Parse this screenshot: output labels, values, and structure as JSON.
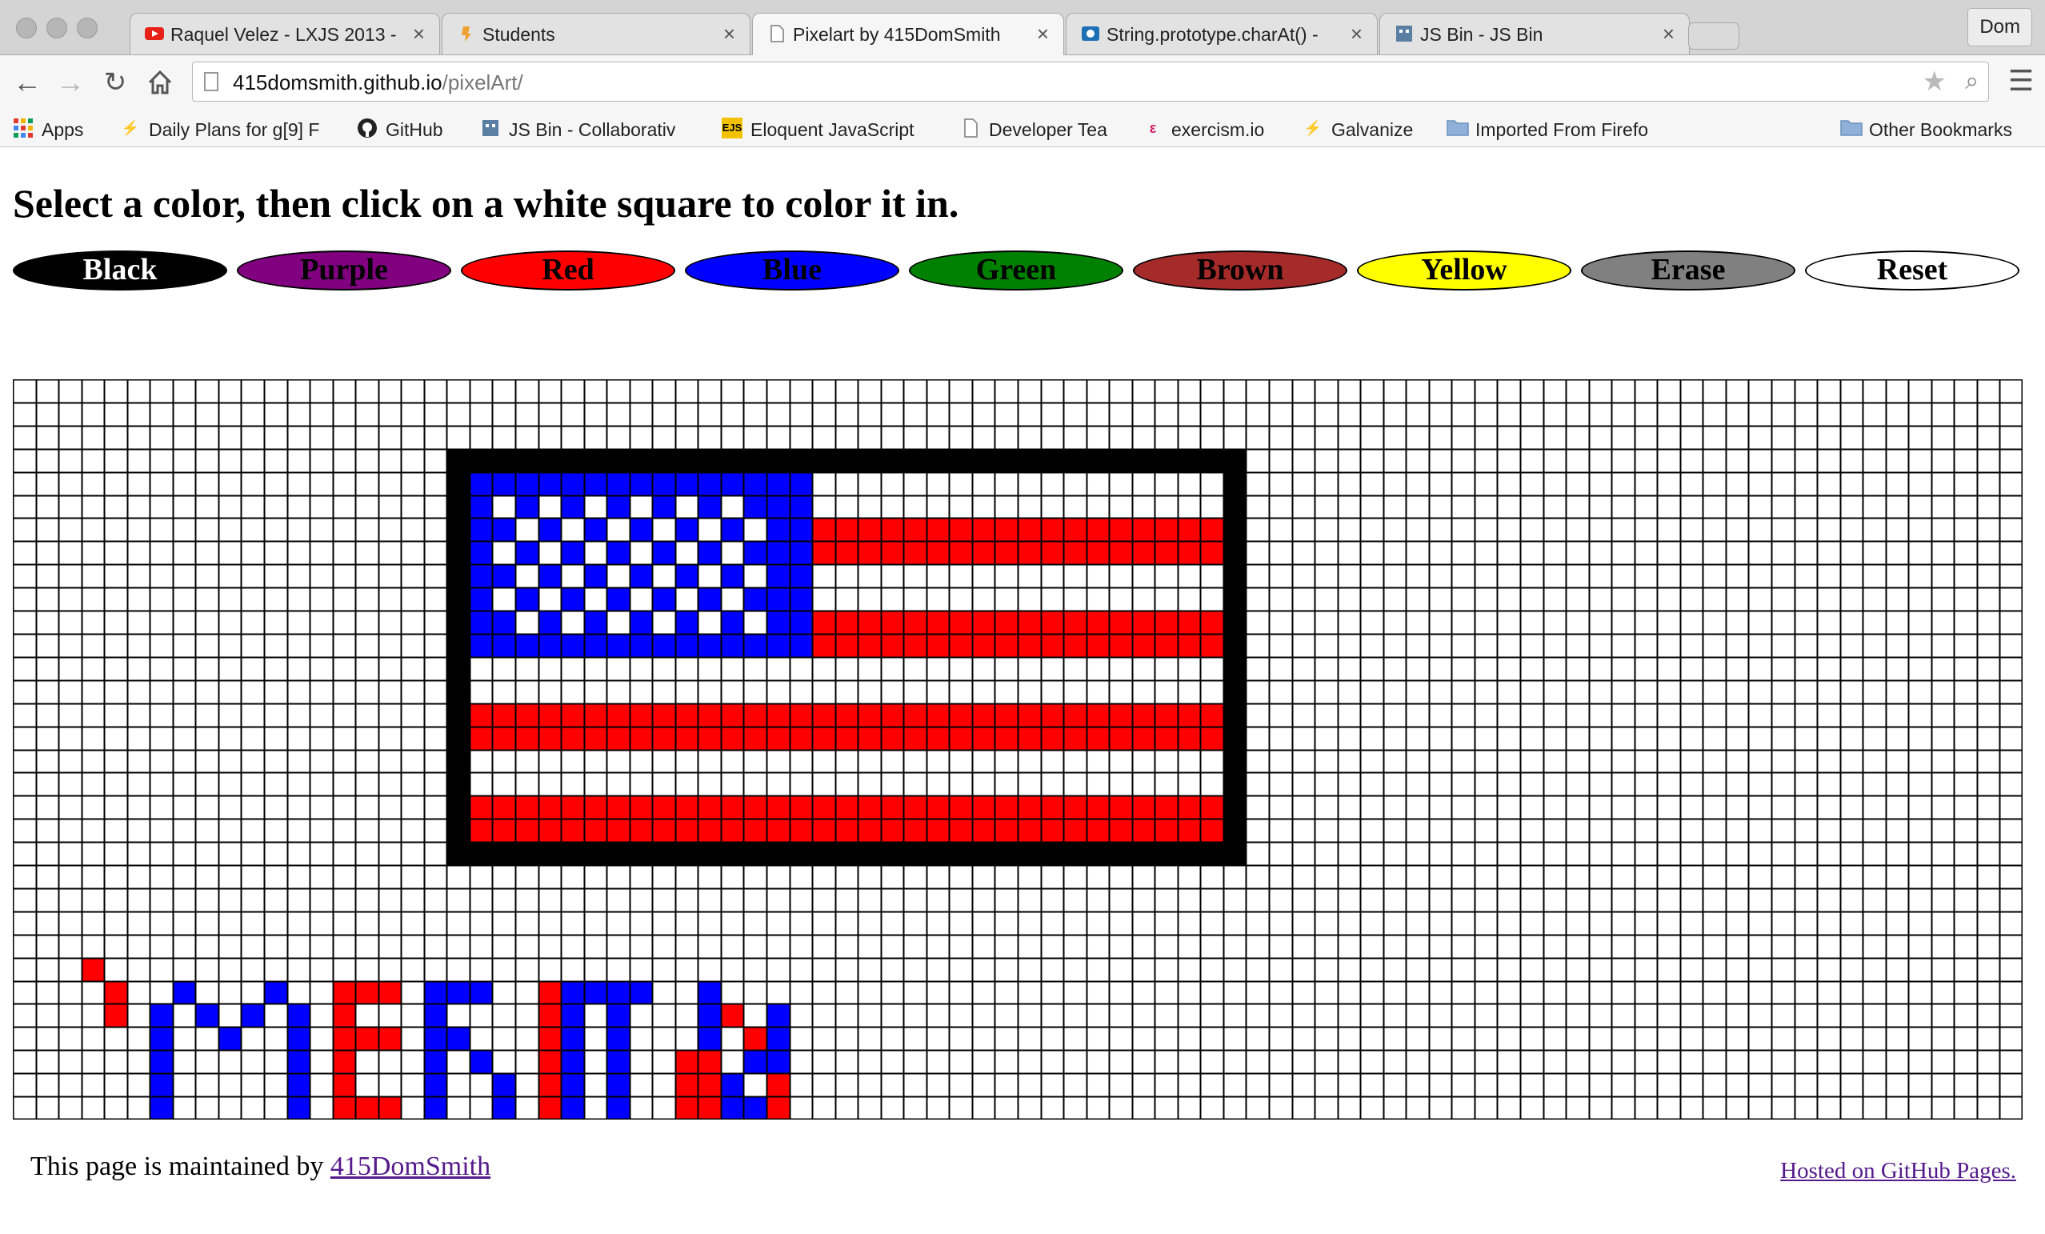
{
  "browser": {
    "tabs": [
      {
        "title": "Raquel Velez - LXJS 2013 -",
        "icon": "youtube-icon",
        "icon_color": "#e62117",
        "active": false
      },
      {
        "title": "Students",
        "icon": "galvanize-icon",
        "icon_color": "#f0a030",
        "active": false
      },
      {
        "title": "Pixelart by 415DomSmith",
        "icon": "page-icon",
        "icon_color": "#999999",
        "active": true
      },
      {
        "title": "String.prototype.charAt() -",
        "icon": "mdn-icon",
        "icon_color": "#1f6fb5",
        "active": false
      },
      {
        "title": "JS Bin - JS Bin",
        "icon": "jsbin-icon",
        "icon_color": "#5b7fa3",
        "active": false
      }
    ],
    "profile_name": "Dom",
    "url_host": "415domsmith.github.io",
    "url_path": "/pixelArt/",
    "bookmarks": [
      {
        "label": "Apps",
        "icon": "apps-grid-icon"
      },
      {
        "label": "Daily Plans for g[9] F",
        "icon": "galvanize-icon"
      },
      {
        "label": "GitHub",
        "icon": "github-icon"
      },
      {
        "label": "JS Bin - Collaborativ",
        "icon": "jsbin-icon"
      },
      {
        "label": "Eloquent JavaScript",
        "icon": "ejs-icon"
      },
      {
        "label": "Developer Tea",
        "icon": "page-icon"
      },
      {
        "label": "exercism.io",
        "icon": "exercism-icon"
      },
      {
        "label": "Galvanize",
        "icon": "galvanize-icon"
      },
      {
        "label": "Imported From Firefo",
        "icon": "folder-icon"
      }
    ],
    "other_bookmarks": "Other Bookmarks"
  },
  "page": {
    "heading": "Select a color, then click on a white square to color it in.",
    "buttons": [
      {
        "label": "Black",
        "bg": "#000000",
        "fg": "#ffffff"
      },
      {
        "label": "Purple",
        "bg": "#800080",
        "fg": "#000000"
      },
      {
        "label": "Red",
        "bg": "#ff0000",
        "fg": "#000000"
      },
      {
        "label": "Blue",
        "bg": "#0000ff",
        "fg": "#000000"
      },
      {
        "label": "Green",
        "bg": "#008000",
        "fg": "#000000"
      },
      {
        "label": "Brown",
        "bg": "#a52a2a",
        "fg": "#000000"
      },
      {
        "label": "Yellow",
        "bg": "#ffff00",
        "fg": "#000000"
      },
      {
        "label": "Erase",
        "bg": "#808080",
        "fg": "#000000"
      },
      {
        "label": "Reset",
        "bg": "#ffffff",
        "fg": "#000000"
      }
    ],
    "canvas": {
      "columns": 88,
      "rows": 32,
      "colors": {
        "K": "#000000",
        "B": "#0000ff",
        "R": "#ff0000",
        "W": "#ffffff"
      },
      "fills": [
        {
          "color": "K",
          "col": 19,
          "row": 3,
          "w": 35,
          "h": 1
        },
        {
          "color": "K",
          "col": 19,
          "row": 20,
          "w": 35,
          "h": 1
        },
        {
          "color": "K",
          "col": 19,
          "row": 4,
          "w": 1,
          "h": 16
        },
        {
          "color": "K",
          "col": 53,
          "row": 4,
          "w": 1,
          "h": 16
        },
        {
          "color": "B",
          "col": 20,
          "row": 4,
          "w": 15,
          "h": 8
        },
        {
          "color": "R",
          "col": 35,
          "row": 6,
          "w": 18,
          "h": 2
        },
        {
          "color": "R",
          "col": 35,
          "row": 10,
          "w": 18,
          "h": 2
        },
        {
          "color": "R",
          "col": 20,
          "row": 14,
          "w": 33,
          "h": 2
        },
        {
          "color": "R",
          "col": 20,
          "row": 18,
          "w": 33,
          "h": 2
        }
      ],
      "star_area": {
        "color": "W",
        "col": 21,
        "row": 5,
        "w": 12,
        "h": 6
      },
      "letters": {
        "B": [
          [
            6,
            27
          ],
          [
            6,
            28
          ],
          [
            6,
            29
          ],
          [
            6,
            30
          ],
          [
            6,
            31
          ],
          [
            7,
            26
          ],
          [
            8,
            27
          ],
          [
            9,
            28
          ],
          [
            10,
            27
          ],
          [
            11,
            26
          ],
          [
            12,
            27
          ],
          [
            12,
            28
          ],
          [
            12,
            29
          ],
          [
            12,
            30
          ],
          [
            12,
            31
          ],
          [
            18,
            26
          ],
          [
            18,
            27
          ],
          [
            18,
            28
          ],
          [
            18,
            29
          ],
          [
            18,
            30
          ],
          [
            18,
            31
          ],
          [
            19,
            26
          ],
          [
            20,
            26
          ],
          [
            19,
            28
          ],
          [
            20,
            29
          ],
          [
            21,
            30
          ],
          [
            21,
            31
          ],
          [
            24,
            26
          ],
          [
            24,
            27
          ],
          [
            24,
            28
          ],
          [
            24,
            29
          ],
          [
            24,
            30
          ],
          [
            24,
            31
          ],
          [
            25,
            26
          ],
          [
            26,
            26
          ],
          [
            27,
            26
          ],
          [
            26,
            27
          ],
          [
            26,
            28
          ],
          [
            26,
            29
          ],
          [
            26,
            30
          ],
          [
            26,
            31
          ],
          [
            30,
            26
          ],
          [
            30,
            27
          ],
          [
            30,
            28
          ],
          [
            30,
            29
          ],
          [
            31,
            31
          ],
          [
            31,
            30
          ],
          [
            32,
            31
          ],
          [
            32,
            29
          ],
          [
            33,
            27
          ],
          [
            33,
            28
          ],
          [
            33,
            29
          ]
        ],
        "R": [
          [
            3,
            25
          ],
          [
            4,
            26
          ],
          [
            4,
            27
          ],
          [
            14,
            26
          ],
          [
            14,
            27
          ],
          [
            14,
            28
          ],
          [
            14,
            29
          ],
          [
            14,
            30
          ],
          [
            14,
            31
          ],
          [
            15,
            26
          ],
          [
            16,
            26
          ],
          [
            15,
            28
          ],
          [
            16,
            28
          ],
          [
            15,
            31
          ],
          [
            16,
            31
          ],
          [
            23,
            26
          ],
          [
            23,
            27
          ],
          [
            23,
            28
          ],
          [
            23,
            29
          ],
          [
            23,
            30
          ],
          [
            23,
            31
          ],
          [
            29,
            29
          ],
          [
            29,
            30
          ],
          [
            29,
            31
          ],
          [
            30,
            29
          ],
          [
            30,
            30
          ],
          [
            30,
            31
          ],
          [
            31,
            27
          ],
          [
            32,
            28
          ],
          [
            33,
            30
          ],
          [
            33,
            31
          ]
        ],
        "W": [
          [
            15,
            29
          ],
          [
            15,
            30
          ]
        ]
      }
    },
    "footer_prefix": "This page is maintained by ",
    "footer_link": "415DomSmith",
    "hosted_link": "Hosted on GitHub Pages."
  }
}
